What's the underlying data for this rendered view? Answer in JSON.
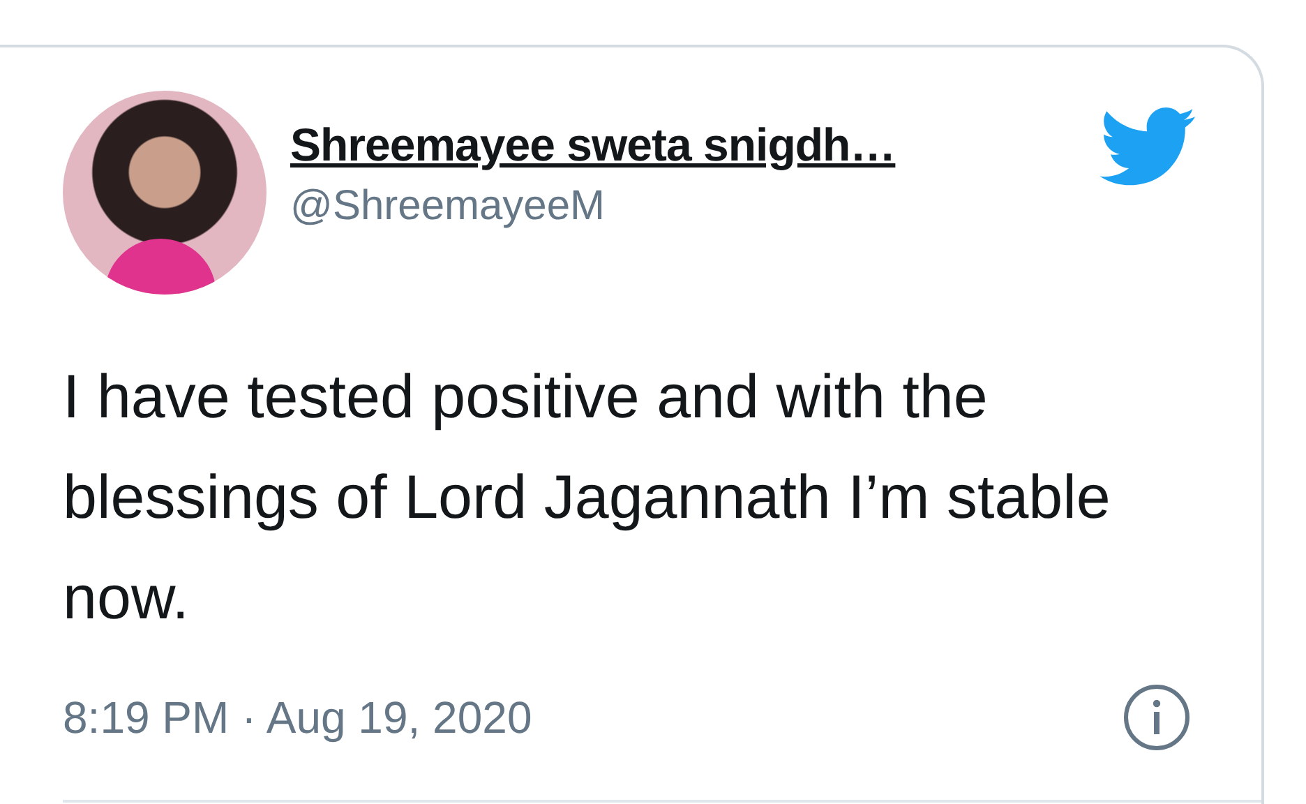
{
  "tweet": {
    "author": {
      "name": "Shreemayee sweta snigdh…",
      "handle": "@ShreemayeeM"
    },
    "text": "I have tested positive and with the blessings of Lord Jagannath I’m stable now.",
    "timestamp": "8:19 PM · Aug 19, 2020"
  }
}
